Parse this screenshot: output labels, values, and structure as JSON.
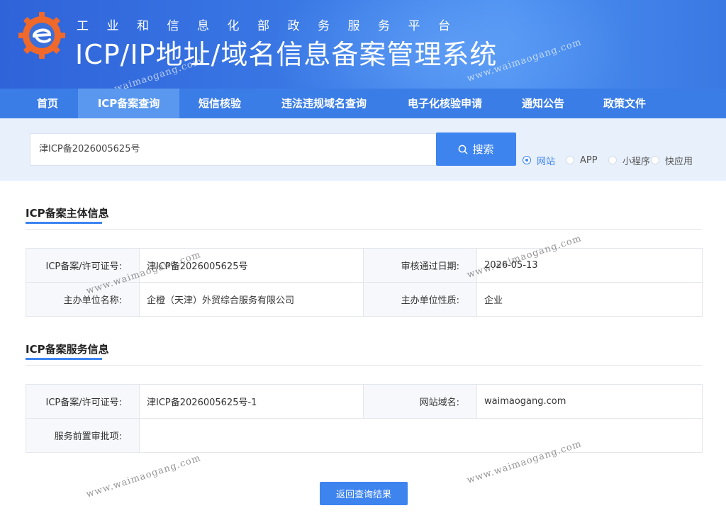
{
  "header": {
    "subtitle": "工业和信息化部政务服务平台",
    "title": "ICP/IP地址/域名信息备案管理系统"
  },
  "nav": {
    "items": [
      {
        "label": "首页"
      },
      {
        "label": "ICP备案查询",
        "active": true
      },
      {
        "label": "短信核验"
      },
      {
        "label": "违法违规域名查询"
      },
      {
        "label": "电子化核验申请"
      },
      {
        "label": "通知公告"
      },
      {
        "label": "政策文件"
      }
    ]
  },
  "search": {
    "value": "津ICP备2026005625号",
    "button_label": "搜索",
    "button_icon": "search-icon",
    "types": [
      {
        "label": "网站",
        "checked": true
      },
      {
        "label": "APP",
        "checked": false
      },
      {
        "label": "小程序",
        "checked": false
      },
      {
        "label": "快应用",
        "checked": false
      }
    ]
  },
  "entity": {
    "title": "ICP备案主体信息",
    "rows": [
      {
        "l1": "ICP备案/许可证号:",
        "v1": "津ICP备2026005625号",
        "l2": "审核通过日期:",
        "v2": "2026-05-13"
      },
      {
        "l1": "主办单位名称:",
        "v1": "企橙（天津）外贸综合服务有限公司",
        "l2": "主办单位性质:",
        "v2": "企业"
      }
    ]
  },
  "service": {
    "title": "ICP备案服务信息",
    "rows": [
      {
        "l1": "ICP备案/许可证号:",
        "v1": "津ICP备2026005625号-1",
        "l2": "网站域名:",
        "v2": "waimaogang.com"
      },
      {
        "l1": "服务前置审批项:",
        "v1": ""
      }
    ]
  },
  "back_button": "返回查询结果",
  "watermark": "www.waimaogang.com",
  "colors": {
    "primary": "#3d84ef",
    "header": "#3b7ae6",
    "nav_active": "#5a98ef"
  }
}
